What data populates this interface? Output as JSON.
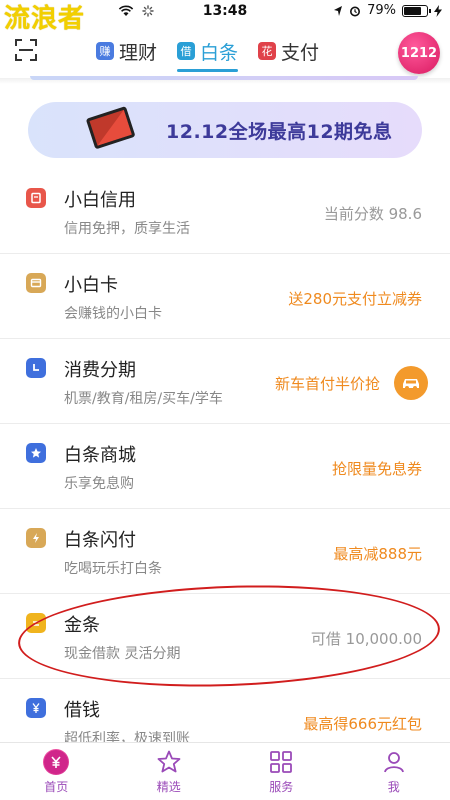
{
  "status_bar": {
    "watermark": "流浪者",
    "time": "13:48",
    "battery": "79%",
    "battery_level": 0.79
  },
  "header": {
    "tabs": [
      {
        "badge": "赚",
        "label": "理财",
        "badge_color": "#4a7be0"
      },
      {
        "badge": "借",
        "label": "白条",
        "badge_color": "#2a9fd6",
        "active": true
      },
      {
        "badge": "花",
        "label": "支付",
        "badge_color": "#e0424a"
      }
    ],
    "promo": "1212"
  },
  "banner": {
    "text": "12.12全场最高12期免息"
  },
  "list": [
    {
      "title": "小白信用",
      "sub": "信用免押，质享生活",
      "value": "当前分数 98.6",
      "value_style": "gray",
      "icon_color": "#e8564a",
      "icon": "wallet-icon"
    },
    {
      "title": "小白卡",
      "sub": "会赚钱的小白卡",
      "value": "送280元支付立减券",
      "value_style": "orange",
      "icon_color": "#d8a857",
      "icon": "card-icon"
    },
    {
      "title": "消费分期",
      "sub": "机票/教育/租房/买车/学车",
      "value": "新车首付半价抢",
      "value_style": "orange",
      "icon_color": "#3f6fdd",
      "icon": "clock-icon"
    },
    {
      "title": "白条商城",
      "sub": "乐享免息购",
      "value": "抢限量免息券",
      "value_style": "orange",
      "icon_color": "#3f6fdd",
      "icon": "star-icon"
    },
    {
      "title": "白条闪付",
      "sub": "吃喝玩乐打白条",
      "value": "最高减888元",
      "value_style": "orange",
      "icon_color": "#d8a857",
      "icon": "lightning-icon"
    },
    {
      "title": "金条",
      "sub": "现金借款 灵活分期",
      "value": "可借 10,000.00",
      "value_style": "gray",
      "icon_color": "#f0b41e",
      "icon": "coin-icon"
    },
    {
      "title": "借钱",
      "sub": "超低利率，极速到账",
      "value": "最高得666元红包",
      "value_style": "orange",
      "icon_color": "#3f6fdd",
      "icon": "yen-icon"
    }
  ],
  "bottom_nav": [
    {
      "label": "首页",
      "icon": "home-icon",
      "active": true
    },
    {
      "label": "精选",
      "icon": "star-outline-icon"
    },
    {
      "label": "服务",
      "icon": "grid-icon"
    },
    {
      "label": "我",
      "icon": "user-icon"
    }
  ],
  "colors": {
    "accent": "#2a9fd6",
    "orange": "#ef8a1f",
    "nav_purple": "#9a4ab8"
  }
}
